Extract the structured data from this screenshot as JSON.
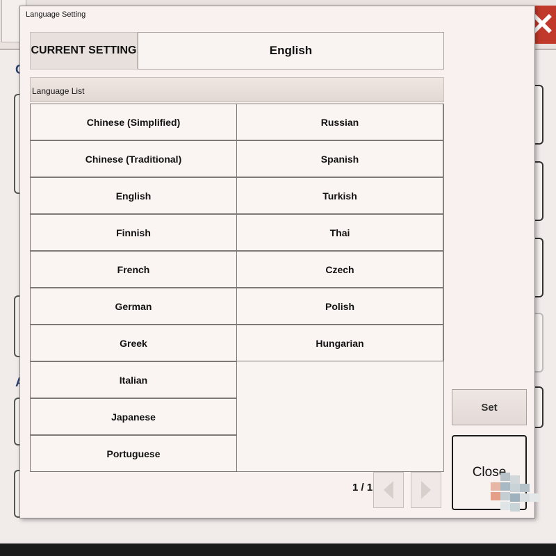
{
  "dialog": {
    "title": "Language Setting",
    "current_setting_label": "CURRENT SETTING",
    "current_setting_value": "English",
    "list_header": "Language List",
    "languages": [
      "Chinese (Simplified)",
      "Chinese (Traditional)",
      "English",
      "Finnish",
      "French",
      "German",
      "Greek",
      "Italian",
      "Japanese",
      "Portuguese",
      "Russian",
      "Spanish",
      "Turkish",
      "Thai",
      "Czech",
      "Polish",
      "Hungarian"
    ],
    "page_indicator": "1 / 1",
    "set_label": "Set",
    "close_label": "Close"
  },
  "background": {
    "heading_1": "C",
    "heading_2": "Ap",
    "close_glyph": "✕"
  },
  "colors": {
    "close_red": "#c0392b",
    "dialog_bg": "#f8f1ef"
  }
}
